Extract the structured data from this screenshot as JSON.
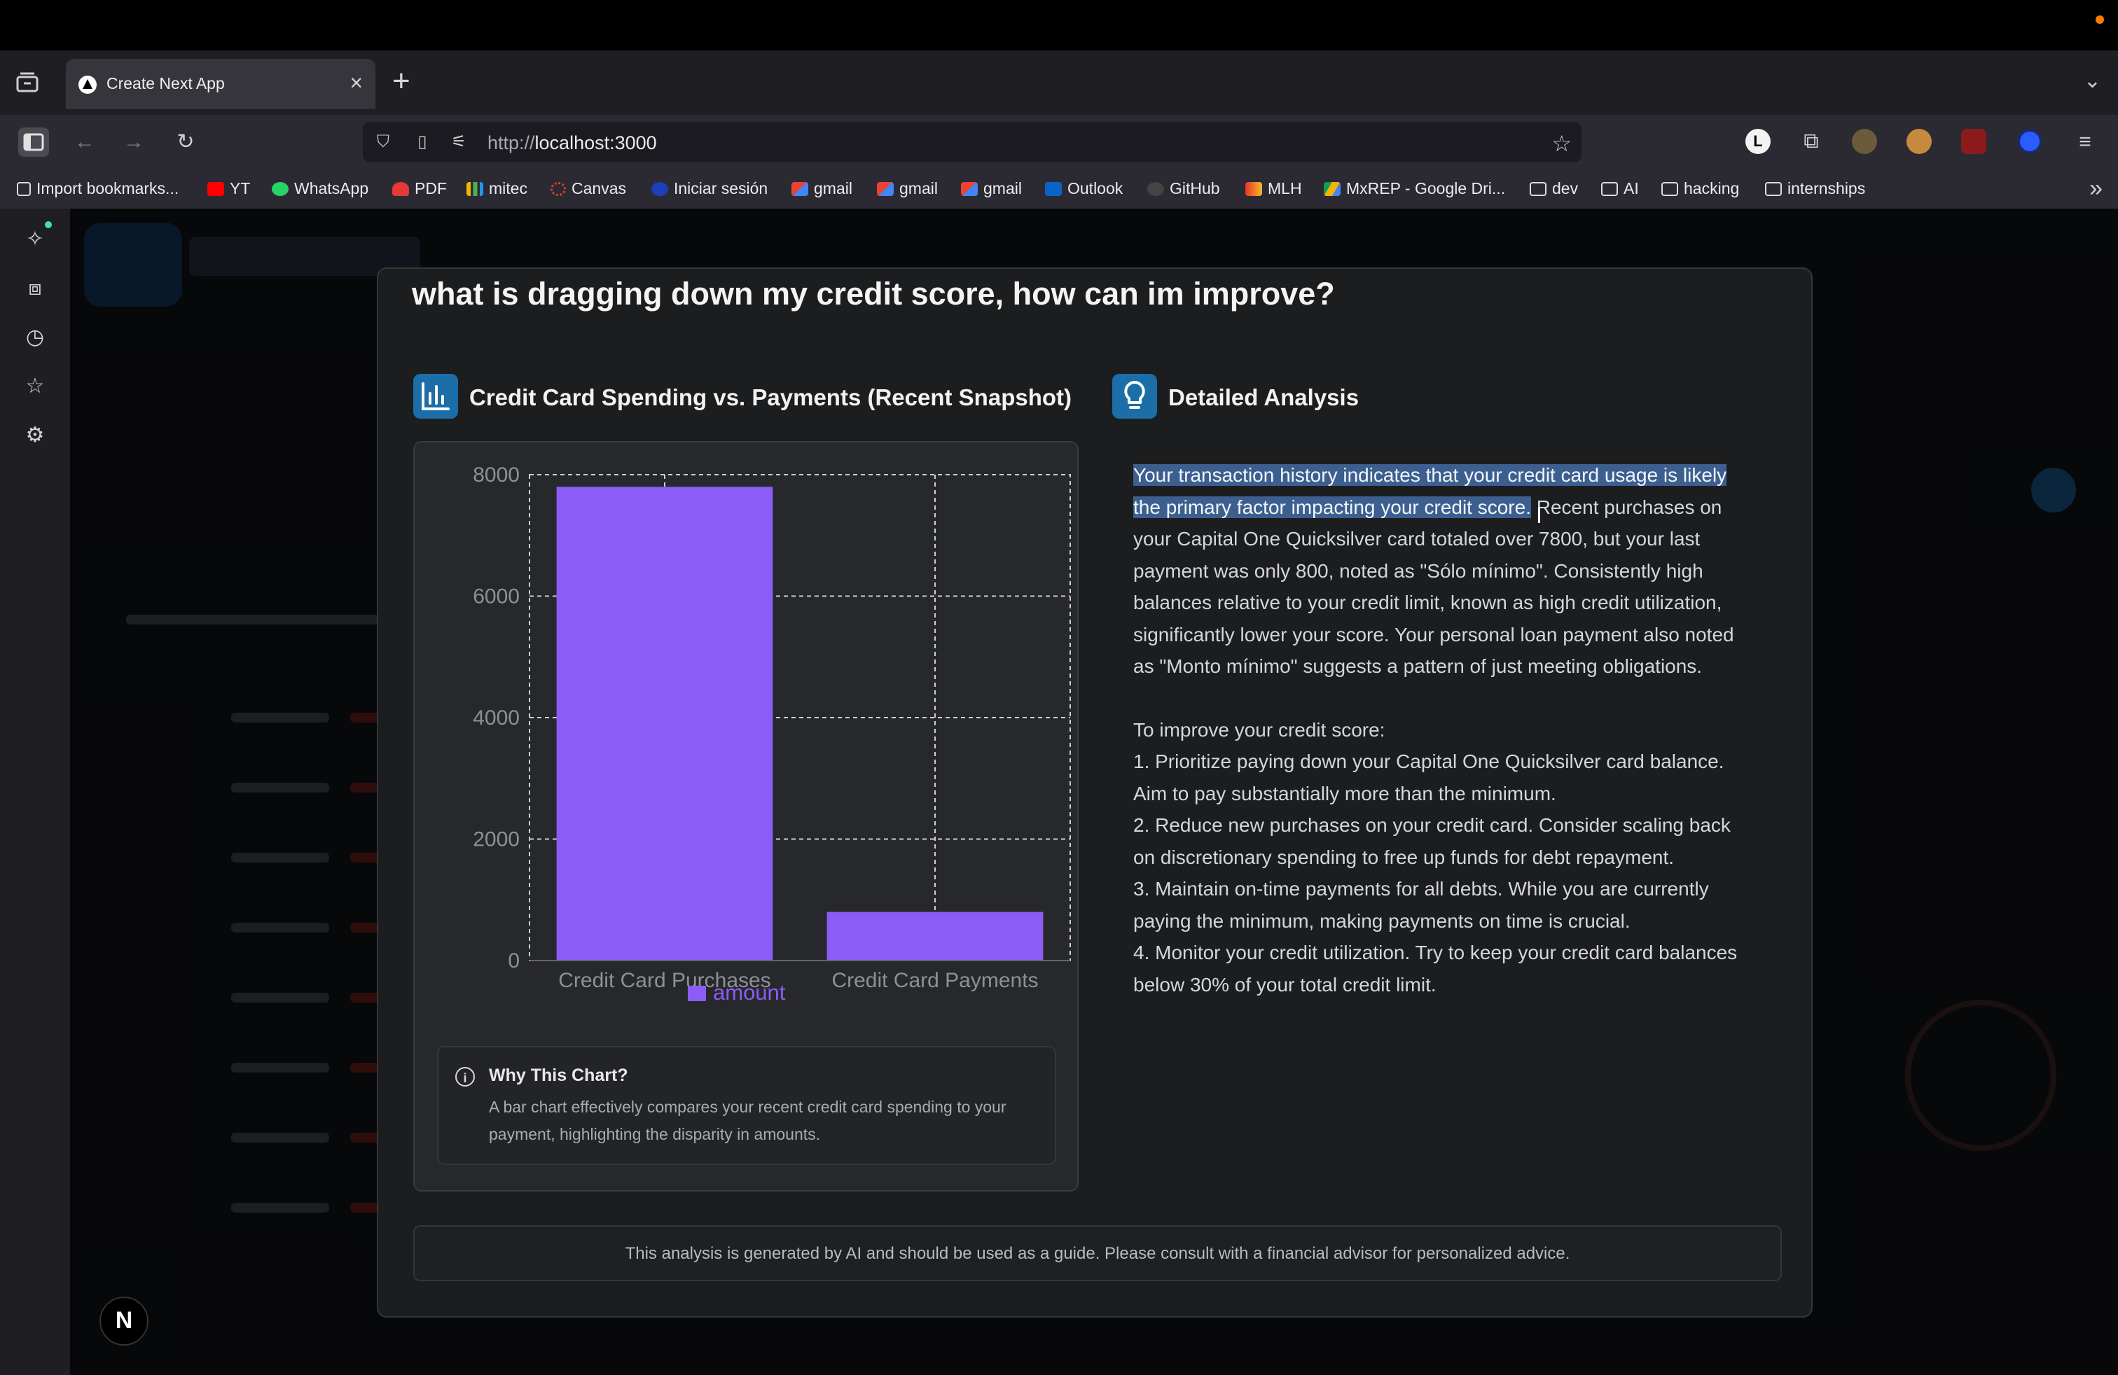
{
  "browser": {
    "tab_title": "Create Next App",
    "url_scheme": "http://",
    "url_host": "localhost",
    "url_rest": ":3000",
    "bookmarks": [
      {
        "label": "Import bookmarks...",
        "icon": "import-icon"
      },
      {
        "label": "YT",
        "icon": "youtube-icon"
      },
      {
        "label": "WhatsApp",
        "icon": "whatsapp-icon"
      },
      {
        "label": "PDF",
        "icon": "heart-icon"
      },
      {
        "label": "mitec",
        "icon": "bars-icon"
      },
      {
        "label": "Canvas",
        "icon": "canvas-icon"
      },
      {
        "label": "Iniciar sesión",
        "icon": "globe-icon"
      },
      {
        "label": "gmail",
        "icon": "gmail-icon"
      },
      {
        "label": "gmail",
        "icon": "gmail-icon"
      },
      {
        "label": "gmail",
        "icon": "gmail-icon"
      },
      {
        "label": "Outlook",
        "icon": "outlook-icon"
      },
      {
        "label": "GitHub",
        "icon": "github-icon"
      },
      {
        "label": "MLH",
        "icon": "mlh-icon"
      },
      {
        "label": "MxREP - Google Dri...",
        "icon": "google-drive-icon"
      },
      {
        "label": "dev",
        "icon": "folder-icon"
      },
      {
        "label": "AI",
        "icon": "folder-icon"
      },
      {
        "label": "hacking",
        "icon": "folder-icon"
      },
      {
        "label": "internships",
        "icon": "folder-icon"
      }
    ]
  },
  "modal": {
    "title": "what is dragging down my credit score, how can im improve?",
    "chart_section_title": "Credit Card Spending vs. Payments (Recent Snapshot)",
    "analysis_section_title": "Detailed Analysis",
    "why_title": "Why This Chart?",
    "why_body": "A bar chart effectively compares your recent credit card spending to your payment, highlighting the disparity in amounts.",
    "analysis_highlighted": "Your transaction history indicates that your credit card usage is likely the primary factor impacting your credit score.",
    "analysis_rest": " Recent purchases on your Capital One Quicksilver card totaled over 7800, but your last payment was only 800, noted as \"Sólo mínimo\". Consistently high balances relative to your credit limit, known as high credit utilization, significantly lower your score. Your personal loan payment also noted as \"Monto mínimo\" suggests a pattern of just meeting obligations.",
    "improve_heading": "To improve your credit score:",
    "steps": [
      "1.  Prioritize paying down your Capital One Quicksilver card balance. Aim to pay substantially more than the minimum.",
      "2.  Reduce new purchases on your credit card. Consider scaling back on discretionary spending to free up funds for debt repayment.",
      "3.  Maintain on-time payments for all debts. While you are currently paying the minimum, making payments on time is crucial.",
      "4.  Monitor your credit utilization. Try to keep your credit card balances below 30% of your total credit limit."
    ],
    "disclaimer": "This analysis is generated by AI and should be used as a guide. Please consult with a financial advisor for personalized advice."
  },
  "chart_data": {
    "type": "bar",
    "categories": [
      "Credit Card Purchases",
      "Credit Card Payments"
    ],
    "series": [
      {
        "name": "amount",
        "values": [
          7800,
          800
        ],
        "color": "#8b5cf6"
      }
    ],
    "y_ticks": [
      "0",
      "2000",
      "4000",
      "6000",
      "8000"
    ],
    "ylim": [
      0,
      8000
    ],
    "grid": true,
    "legend": "bottom"
  },
  "colors": {
    "accent_blue": "#1b6ea8",
    "bar": "#8b5cf6",
    "highlight": "#3d5f8f"
  },
  "page": {
    "badge_letter": "N"
  }
}
